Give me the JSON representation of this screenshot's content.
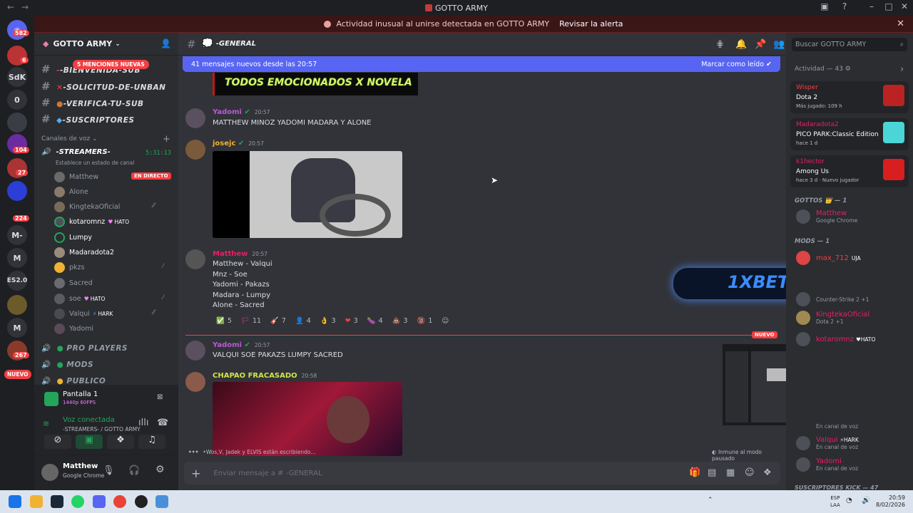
{
  "window": {
    "title": "GOTTO ARMY",
    "back": "←",
    "forward": "→"
  },
  "alert": {
    "text": "Actividad inusual al unirse detectada en GOTTO ARMY",
    "action": "Revisar la alerta"
  },
  "rail": {
    "dm_badge": "582",
    "badges": [
      "6",
      "104",
      "27",
      "224",
      "267"
    ],
    "texts": [
      "SdK",
      "0",
      "M-",
      "M",
      "ES2.0",
      "M"
    ],
    "new_label": "NUEVO"
  },
  "server": {
    "name": "GOTTO ARMY",
    "mentions_badge": "5 MENCIONES NUEVAS",
    "channels": [
      "-BIENVENIDA-SUB",
      "-SOLICITUD-DE-UNBAN",
      "-VERIFICA-TU-SUB",
      "-SUSCRIPTORES"
    ],
    "voice_header": "Canales de voz",
    "voice_channel": "-STREAMERS-",
    "voice_timer": "5:31:13",
    "voice_status": "Establece un estado de canal",
    "live_badge": "EN DIRECTO",
    "voice_users": [
      {
        "name": "Matthew",
        "tag": ""
      },
      {
        "name": "Alone",
        "tag": ""
      },
      {
        "name": "KingtekaOficial",
        "tag": ""
      },
      {
        "name": "kotaromnz",
        "tag": "HATO"
      },
      {
        "name": "Lumpy",
        "tag": ""
      },
      {
        "name": "Madaradota2",
        "tag": ""
      },
      {
        "name": "pkzs",
        "tag": ""
      },
      {
        "name": "Sacred",
        "tag": ""
      },
      {
        "name": "soe",
        "tag": "HATO"
      },
      {
        "name": "Valqui",
        "tag": "HARK"
      },
      {
        "name": "Yadomi",
        "tag": ""
      }
    ],
    "categories": [
      "PRO PLAYERS",
      "MODS",
      "PUBLICO"
    ]
  },
  "panel": {
    "screen_title": "Pantalla 1",
    "screen_sub": "1440p 60FPS",
    "voice_connected": "Voz conectada",
    "voice_location": "-STREAMERS- / GOTTO ARMY",
    "user_name": "Matthew",
    "user_status": "Google Chrome"
  },
  "channel": {
    "name": "-GENERAL",
    "new_messages": "41 mensajes nuevos desde las 20:57",
    "mark_read": "Marcar como leído",
    "image_caption": "TODOS EMOCIONADOS X NOVELA",
    "new_divider": "NUEVO",
    "typing": "•Wos,V, Jadek y ELVIS están escribiendo...",
    "immune": "Inmune al modo pausado",
    "composer_placeholder": "Enviar mensaje a #  -GENERAL"
  },
  "messages": [
    {
      "author": "Yadomi",
      "time": "20:57",
      "color": "#b95ad3",
      "lines": [
        "MATTHEW MINOZ YADOMI MADARA Y ALONE"
      ]
    },
    {
      "author": "josejc",
      "time": "20:57",
      "color": "#f0b232",
      "lines": []
    },
    {
      "author": "Matthew",
      "time": "20:57",
      "color": "#e91e63",
      "lines": [
        "Matthew - Valqui",
        "Mnz - Soe",
        "Yadomi - Pakazs",
        "Madara - Lumpy",
        "Alone - Sacred"
      ]
    },
    {
      "author": "Yadomi",
      "time": "20:57",
      "color": "#b95ad3",
      "lines": [
        "VALQUI SOE PAKAZS LUMPY SACRED"
      ]
    },
    {
      "author": "CHAPAO FRACASADO",
      "time": "20:58",
      "color": "#d4e34a",
      "lines": []
    }
  ],
  "reactions": [
    {
      "emoji": "✅",
      "count": "5"
    },
    {
      "emoji": "🏳",
      "count": "11"
    },
    {
      "emoji": "🎸",
      "count": "7"
    },
    {
      "emoji": "👤",
      "count": "4"
    },
    {
      "emoji": "👌",
      "count": "3"
    },
    {
      "emoji": "❤",
      "count": "3"
    },
    {
      "emoji": "🍆",
      "count": "4"
    },
    {
      "emoji": "💩",
      "count": "3"
    },
    {
      "emoji": "🔞",
      "count": "1"
    }
  ],
  "members": {
    "search_placeholder": "Buscar GOTTO ARMY",
    "activity_header": "Actividad — 43",
    "activities": [
      {
        "user": "Wisper",
        "game": "Dota 2",
        "sub": "Más jugado: 109 h"
      },
      {
        "user": "Madaradota2",
        "game": "PICO PARK:Classic Edition",
        "sub": "hace 1 d"
      },
      {
        "user": "k1hector",
        "game": "Among Us",
        "sub": "hace 3 d",
        "extra": "Nuevo jugador"
      }
    ],
    "group_gottos": "GOTTOS",
    "group_gottos_count": "— 1",
    "gottos_member": {
      "name": "Matthew",
      "status": "Google Chrome"
    },
    "group_mods": "MODS — 1",
    "mods_member": {
      "name": "max_712",
      "tag": "UJA"
    },
    "others": [
      {
        "name": "",
        "status": "Counter-Strike 2 +1"
      },
      {
        "name": "KingtekaOficial",
        "status": "Dota 2 +1"
      },
      {
        "name": "kotaromnz",
        "status": "",
        "tag": "HATO"
      },
      {
        "name": "",
        "status": "En canal de voz"
      },
      {
        "name": "Valqui",
        "status": "En canal de voz",
        "tag": "HARK"
      },
      {
        "name": "Yadomi",
        "status": "En canal de voz"
      }
    ],
    "bottom_group": "SUSCRIPTORES KICK — 47"
  },
  "ad": {
    "text": "1XBET"
  },
  "taskbar": {
    "lang": "ESP",
    "lang2": "LAA",
    "time": "20:59",
    "date": "8/02/2026"
  },
  "colors": {
    "accent": "#5865f2",
    "danger": "#f23f43",
    "online": "#23a55a"
  }
}
